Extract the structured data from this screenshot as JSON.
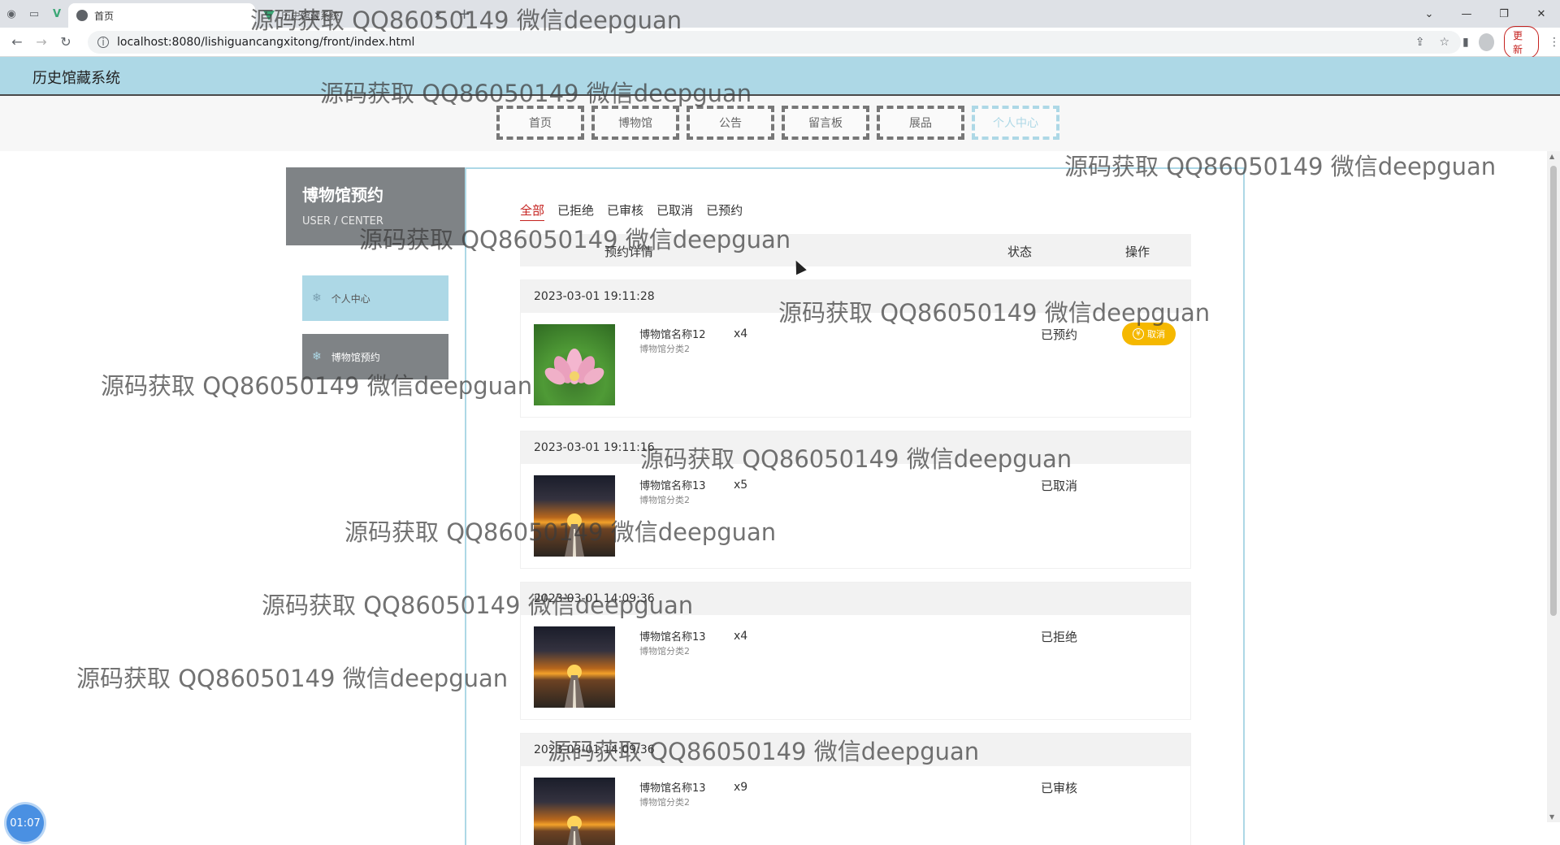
{
  "browser": {
    "tabs": [
      {
        "title": "首页",
        "active": true
      },
      {
        "title": "历史馆藏系统",
        "active": false
      }
    ],
    "new_tab": "+",
    "url": "localhost:8080/lishiguancangxitong/front/index.html",
    "update_label": "更新"
  },
  "site": {
    "title": "历史馆藏系统",
    "nav": [
      "首页",
      "博物馆",
      "公告",
      "留言板",
      "展品",
      "个人中心"
    ],
    "active_nav": "个人中心"
  },
  "sidebar": {
    "title": "博物馆预约",
    "subtitle": "USER / CENTER",
    "items": [
      {
        "label": "个人中心"
      },
      {
        "label": "博物馆预约"
      }
    ]
  },
  "filters": {
    "tabs": [
      "全部",
      "已拒绝",
      "已审核",
      "已取消",
      "已预约"
    ],
    "active": "全部"
  },
  "table": {
    "headers": {
      "detail": "预约详情",
      "status": "状态",
      "action": "操作"
    }
  },
  "orders": [
    {
      "time": "2023-03-01 19:11:28",
      "name": "博物馆名称12",
      "category": "博物馆分类2",
      "qty": "x4",
      "status": "已预约",
      "action": "取消",
      "image": "lotus"
    },
    {
      "time": "2023-03-01 19:11:16",
      "name": "博物馆名称13",
      "category": "博物馆分类2",
      "qty": "x5",
      "status": "已取消",
      "image": "sunset-road"
    },
    {
      "time": "2023-03-01 14:09:36",
      "name": "博物馆名称13",
      "category": "博物馆分类2",
      "qty": "x4",
      "status": "已拒绝",
      "image": "sunset-road"
    },
    {
      "time": "2023-03-01 14:09:36",
      "name": "博物馆名称13",
      "category": "博物馆分类2",
      "qty": "x9",
      "status": "已审核",
      "image": "sunset-road"
    }
  ],
  "timer": "01:07",
  "watermark": "源码获取 QQ86050149 微信deepguan"
}
